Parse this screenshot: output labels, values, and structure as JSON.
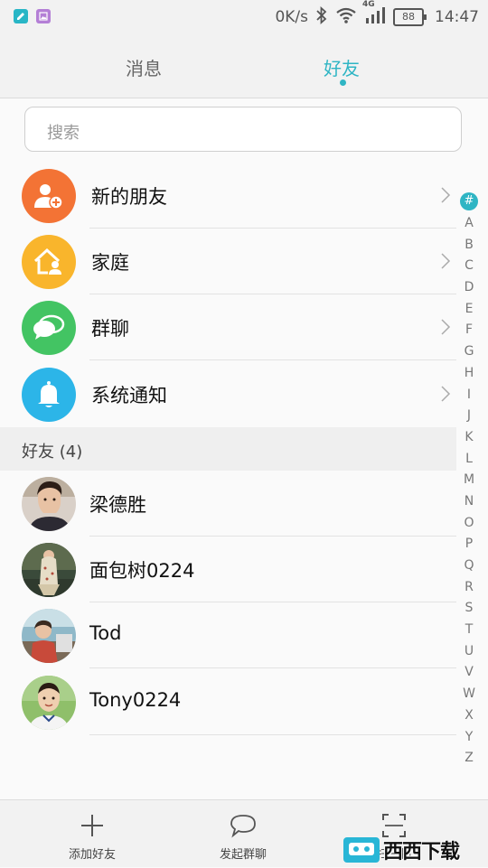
{
  "status_bar": {
    "speed": "0K/s",
    "network": "4G",
    "battery": "88",
    "time": "14:47"
  },
  "tabs": [
    {
      "label": "消息",
      "active": false
    },
    {
      "label": "好友",
      "active": true
    }
  ],
  "accent_color": "#2fb5c4",
  "search": {
    "placeholder": "搜索"
  },
  "functions": [
    {
      "label": "新的朋友",
      "icon": "add-friend-icon",
      "color": "#f37335"
    },
    {
      "label": "家庭",
      "icon": "family-home-icon",
      "color": "#f9b52c"
    },
    {
      "label": "群聊",
      "icon": "group-chat-icon",
      "color": "#43c463"
    },
    {
      "label": "系统通知",
      "icon": "notification-bell-icon",
      "color": "#2cb5e8"
    }
  ],
  "friends_section": {
    "label": "好友 (4)"
  },
  "contacts": [
    {
      "name": "梁德胜"
    },
    {
      "name": "面包树0224"
    },
    {
      "name": "Tod"
    },
    {
      "name": "Tony0224"
    }
  ],
  "index_letters": [
    "#",
    "A",
    "B",
    "C",
    "D",
    "E",
    "F",
    "G",
    "H",
    "I",
    "J",
    "K",
    "L",
    "M",
    "N",
    "O",
    "P",
    "Q",
    "R",
    "S",
    "T",
    "U",
    "V",
    "W",
    "X",
    "Y",
    "Z"
  ],
  "bottom_bar": {
    "add_friend": "添加好友",
    "start_group_chat": "发起群聊",
    "scan": "扫一扫"
  },
  "watermark": {
    "text": "西西下载"
  }
}
